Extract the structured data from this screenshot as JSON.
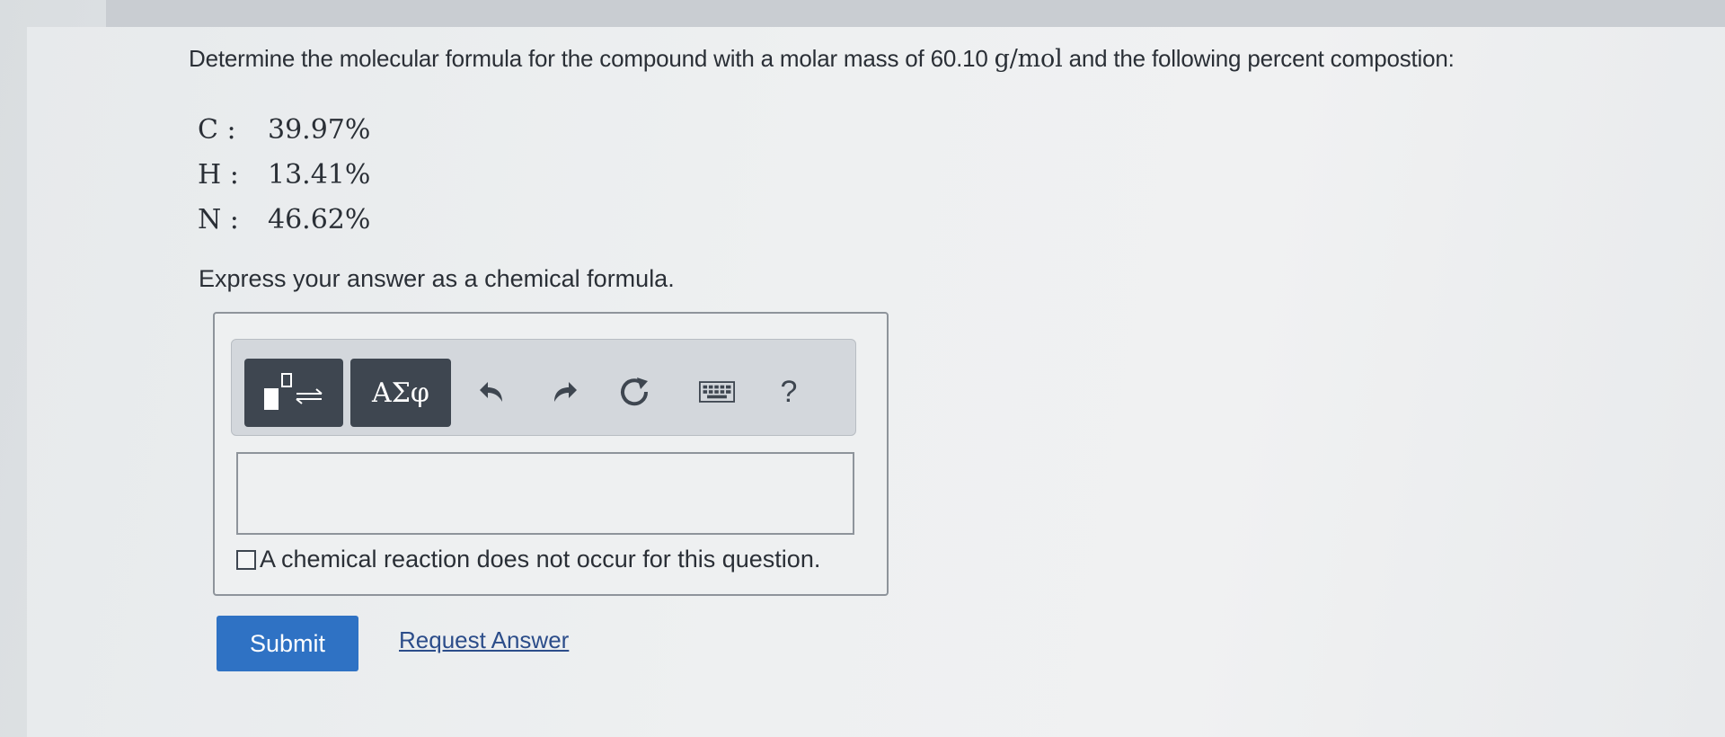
{
  "question": {
    "prefix": "Determine the molecular formula for the compound with a molar mass of 60.10 ",
    "unit": "g/mol",
    "suffix": " and the following percent compostion:"
  },
  "composition": [
    {
      "symbol": "C :",
      "percent": "39.97%"
    },
    {
      "symbol": "H :",
      "percent": "13.41%"
    },
    {
      "symbol": "N :",
      "percent": "46.62%"
    }
  ],
  "instruction": "Express your answer as a chemical formula.",
  "toolbar": {
    "symbols_label": "ΑΣφ",
    "help_label": "?",
    "icons": [
      "templates-icon",
      "undo-icon",
      "redo-icon",
      "reset-icon",
      "keyboard-icon",
      "help-icon"
    ]
  },
  "answer": {
    "value": "",
    "placeholder": ""
  },
  "no_reaction_label": "A chemical reaction does not occur for this question.",
  "actions": {
    "submit_label": "Submit",
    "request_answer_label": "Request Answer"
  },
  "colors": {
    "accent": "#2f72c4",
    "toolbar_button": "#3e4650",
    "link": "#2c4d8a"
  }
}
